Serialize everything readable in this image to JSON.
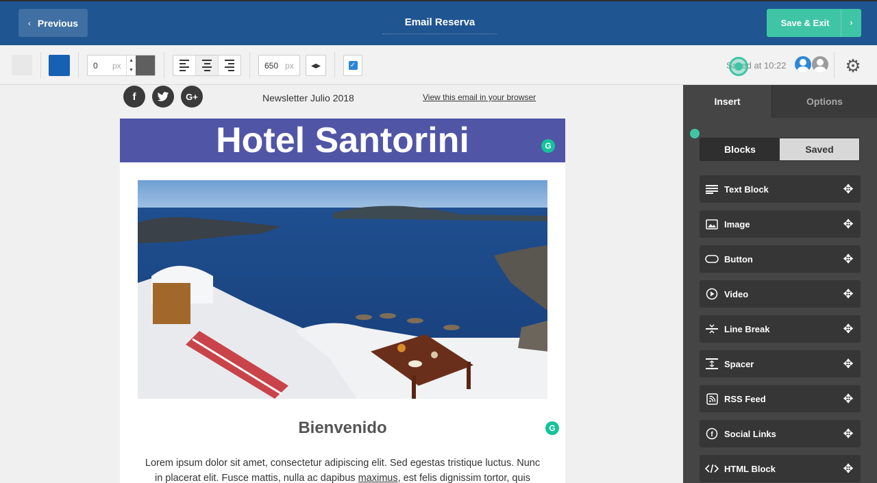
{
  "header": {
    "previous_label": "Previous",
    "title": "Email Reserva",
    "save_label": "Save & Exit"
  },
  "toolbar": {
    "color_light": "#e8e8e8",
    "color_accent": "#1761b4",
    "padding_value": "0",
    "padding_unit": "px",
    "width_value": "650",
    "width_unit": "px",
    "saved_text": "Saved at 10:22"
  },
  "email": {
    "newsletter_text": "Newsletter Julio 2018",
    "view_link": "View this email in your browser",
    "header_title": "Hotel Santorini",
    "header_color": "#5155a6",
    "welcome": "Bienvenido",
    "body_line1": "Lorem ipsum dolor sit amet, consectetur adipiscing elit. Sed egestas tristique luctus. Nunc",
    "body_line2_a": "in placerat elit. Fusce mattis, nulla ac dapibus ",
    "body_line2_link": "maximus",
    "body_line2_b": ", est felis dignissim tortor, quis",
    "social": [
      "facebook-icon",
      "twitter-icon",
      "google-plus-icon"
    ]
  },
  "panel": {
    "tabs": [
      "Insert",
      "Options"
    ],
    "segments": [
      "Blocks",
      "Saved"
    ],
    "blocks": [
      {
        "label": "Text Block",
        "icon": "text-lines-icon"
      },
      {
        "label": "Image",
        "icon": "image-icon"
      },
      {
        "label": "Button",
        "icon": "button-icon"
      },
      {
        "label": "Video",
        "icon": "play-icon"
      },
      {
        "label": "Line Break",
        "icon": "line-break-icon"
      },
      {
        "label": "Spacer",
        "icon": "spacer-icon"
      },
      {
        "label": "RSS Feed",
        "icon": "rss-icon"
      },
      {
        "label": "Social Links",
        "icon": "facebook-circle-icon"
      },
      {
        "label": "HTML Block",
        "icon": "code-icon"
      }
    ]
  }
}
